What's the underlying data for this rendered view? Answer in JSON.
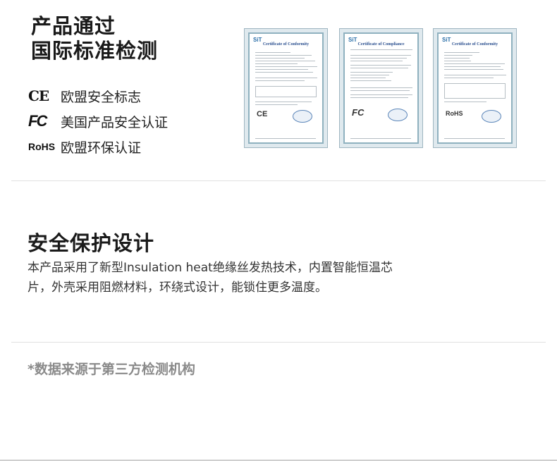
{
  "header": {
    "title_line1": "产品通过",
    "title_line2": "国际标准检测"
  },
  "certifications": [
    {
      "logo": "CE",
      "label": "欧盟安全标志"
    },
    {
      "logo": "FC",
      "label": "美国产品安全认证"
    },
    {
      "logo": "RoHS",
      "label": "欧盟环保认证"
    }
  ],
  "certificate_images": [
    {
      "brand": "SiT",
      "title": "Certificate of Conformity",
      "mark": "CE"
    },
    {
      "brand": "SiT",
      "title": "Certificate of Compliance",
      "mark": "FC"
    },
    {
      "brand": "SiT",
      "title": "Certificate of Conformity",
      "mark": "RoHS"
    }
  ],
  "safety": {
    "title": "安全保护设计",
    "body": "本产品采用了新型Insulation heat绝缘丝发热技术，内置智能恒温芯片，外壳采用阻燃材料，环绕式设计，能锁住更多温度。"
  },
  "footnote": "*数据来源于第三方检测机构"
}
